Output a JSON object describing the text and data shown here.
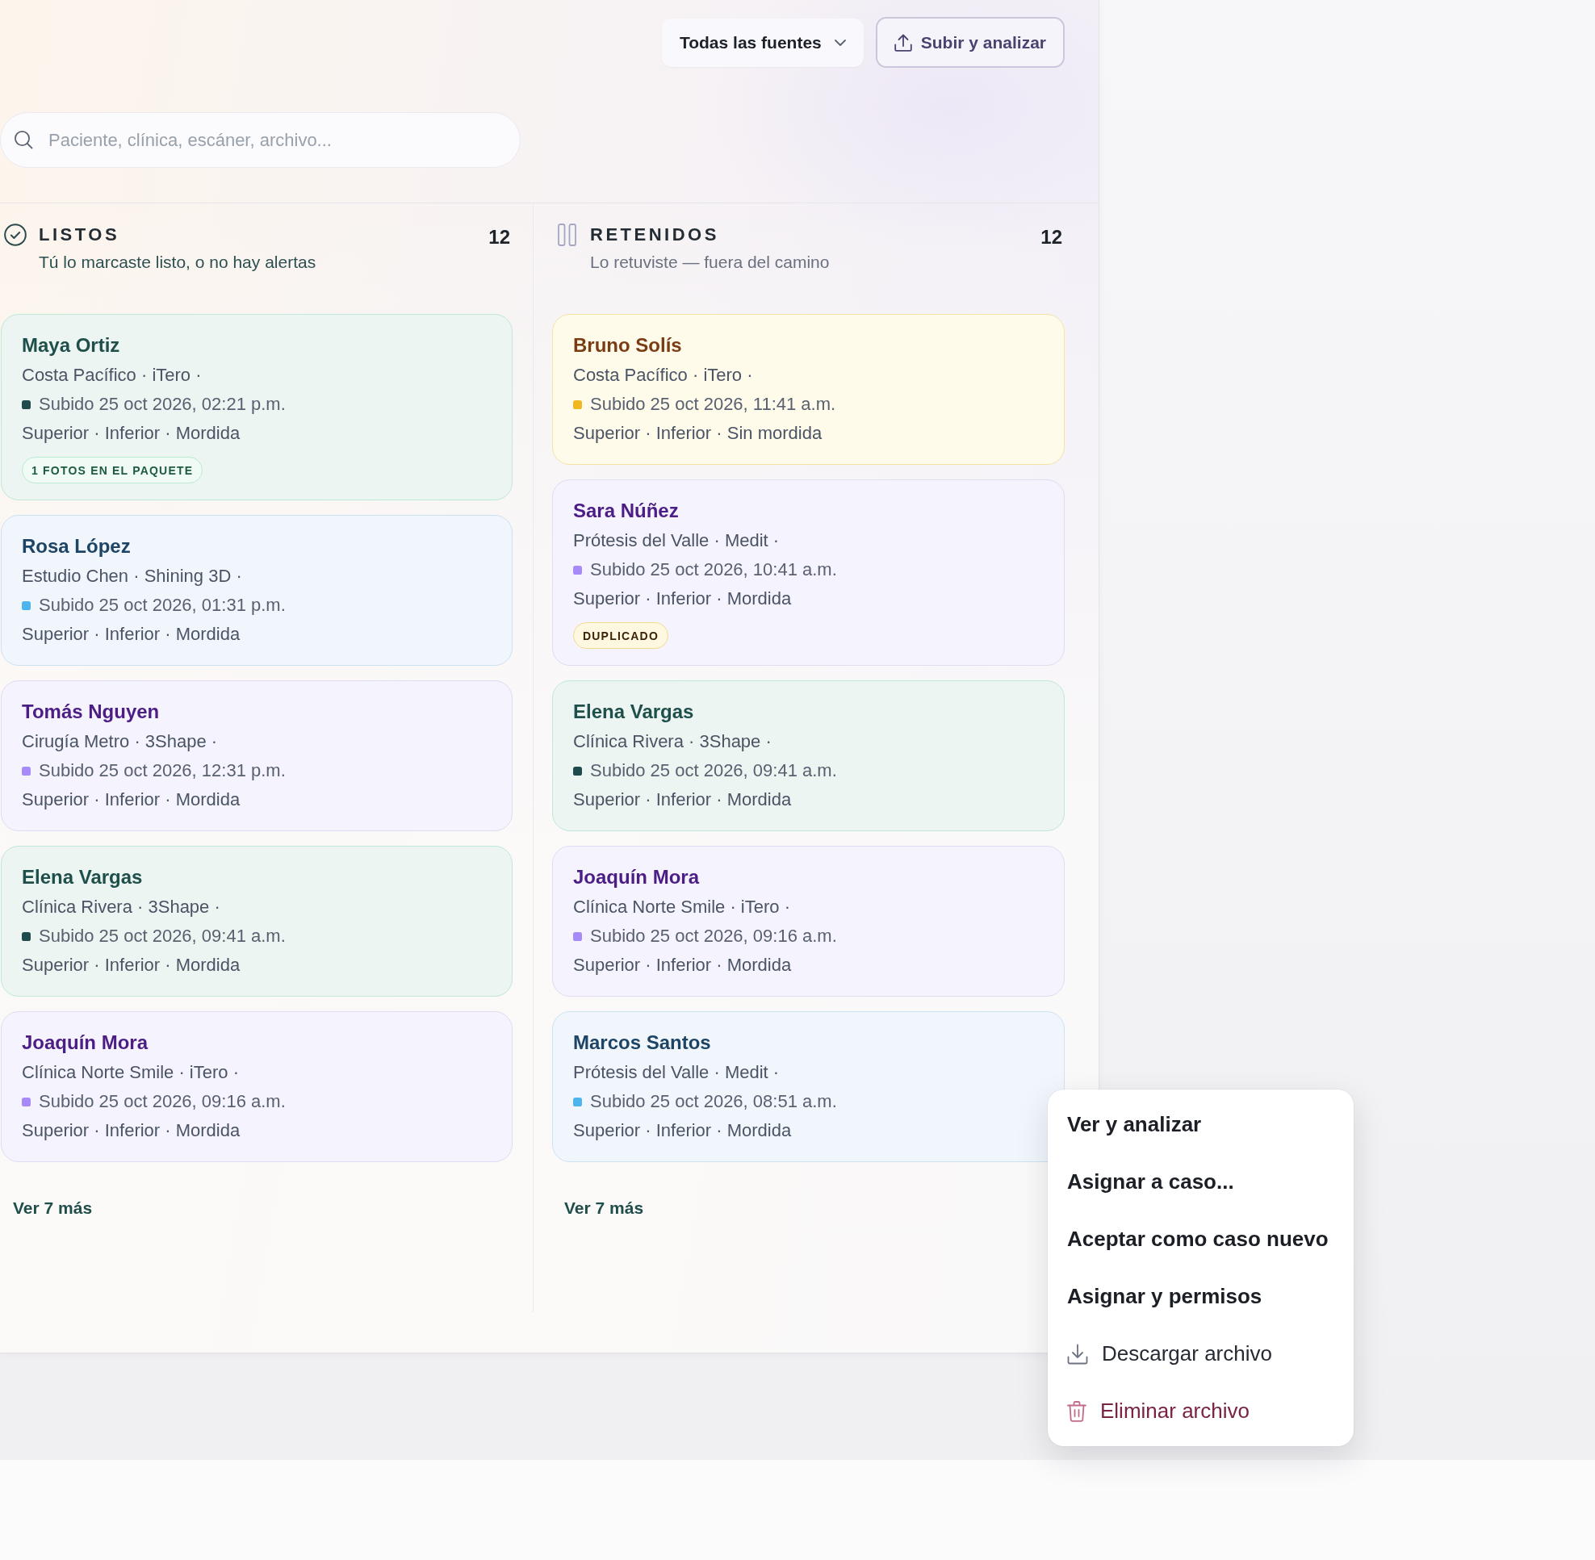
{
  "toolbar": {
    "source_filter": {
      "label": "Todas las fuentes"
    },
    "upload_button": {
      "label": "Subir y analizar"
    }
  },
  "search": {
    "placeholder": "Paciente, clínica, escáner, archivo..."
  },
  "columns": [
    {
      "kind": "ready",
      "title": "LISTOS",
      "subtitle": "Tú lo marcaste listo, o no hay alertas",
      "count": "12",
      "cards": [
        {
          "name": "Maya Ortiz",
          "kind": "teal",
          "meta": "Costa Pacífico · iTero ·",
          "color": "#1f4a4e",
          "uploaded": "Subido 25 oct 2026, 02:21 p.m.",
          "parts": "Superior · Inferior · Mordida",
          "badge": {
            "text": "1 FOTOS EN EL PAQUETE",
            "kind": "green"
          }
        },
        {
          "name": "Rosa López",
          "kind": "sky",
          "meta": "Estudio Chen · Shining 3D ·",
          "color": "#4cb5ee",
          "uploaded": "Subido 25 oct 2026, 01:31 p.m.",
          "parts": "Superior · Inferior · Mordida"
        },
        {
          "name": "Tomás Nguyen",
          "kind": "violet",
          "meta": "Cirugía Metro · 3Shape ·",
          "color": "#a58af8",
          "uploaded": "Subido 25 oct 2026, 12:31 p.m.",
          "parts": "Superior · Inferior · Mordida"
        },
        {
          "name": "Elena Vargas",
          "kind": "teal",
          "meta": "Clínica Rivera · 3Shape ·",
          "color": "#1f4a4e",
          "uploaded": "Subido 25 oct 2026, 09:41 a.m.",
          "parts": "Superior · Inferior · Mordida"
        },
        {
          "name": "Joaquín Mora",
          "kind": "violet",
          "meta": "Clínica Norte Smile · iTero ·",
          "color": "#a58af8",
          "uploaded": "Subido 25 oct 2026, 09:16 a.m.",
          "parts": "Superior · Inferior · Mordida"
        }
      ],
      "more_link": "Ver 7 más"
    },
    {
      "kind": "held",
      "title": "RETENIDOS",
      "subtitle": "Lo retuviste — fuera del camino",
      "count": "12",
      "cards": [
        {
          "name": "Bruno Solís",
          "kind": "amber",
          "meta": "Costa Pacífico · iTero ·",
          "color": "#f2b824",
          "uploaded": "Subido 25 oct 2026, 11:41 a.m.",
          "parts": "Superior · Inferior · Sin mordida"
        },
        {
          "name": "Sara Núñez",
          "kind": "violet",
          "meta": "Prótesis del Valle · Medit ·",
          "color": "#a58af8",
          "uploaded": "Subido 25 oct 2026, 10:41 a.m.",
          "parts": "Superior · Inferior · Mordida",
          "badge": {
            "text": "DUPLICADO",
            "kind": "amber"
          }
        },
        {
          "name": "Elena Vargas",
          "kind": "teal",
          "meta": "Clínica Rivera · 3Shape ·",
          "color": "#1f4a4e",
          "uploaded": "Subido 25 oct 2026, 09:41 a.m.",
          "parts": "Superior · Inferior · Mordida"
        },
        {
          "name": "Joaquín Mora",
          "kind": "violet",
          "meta": "Clínica Norte Smile · iTero ·",
          "color": "#a58af8",
          "uploaded": "Subido 25 oct 2026, 09:16 a.m.",
          "parts": "Superior · Inferior · Mordida"
        },
        {
          "name": "Marcos Santos",
          "kind": "sky",
          "meta": "Prótesis del Valle · Medit ·",
          "color": "#4cb5ee",
          "uploaded": "Subido 25 oct 2026, 08:51 a.m.",
          "parts": "Superior · Inferior · Mordida"
        }
      ],
      "more_link": "Ver 7 más"
    }
  ],
  "context_menu": {
    "items": [
      {
        "kind": "primary",
        "label": "Ver y analizar"
      },
      {
        "kind": "primary",
        "label": "Asignar a caso..."
      },
      {
        "kind": "primary",
        "label": "Aceptar como caso nuevo"
      },
      {
        "kind": "primary",
        "label": "Asignar y permisos"
      },
      {
        "kind": "download",
        "label": "Descargar archivo"
      },
      {
        "kind": "danger",
        "label": "Eliminar archivo"
      }
    ]
  }
}
